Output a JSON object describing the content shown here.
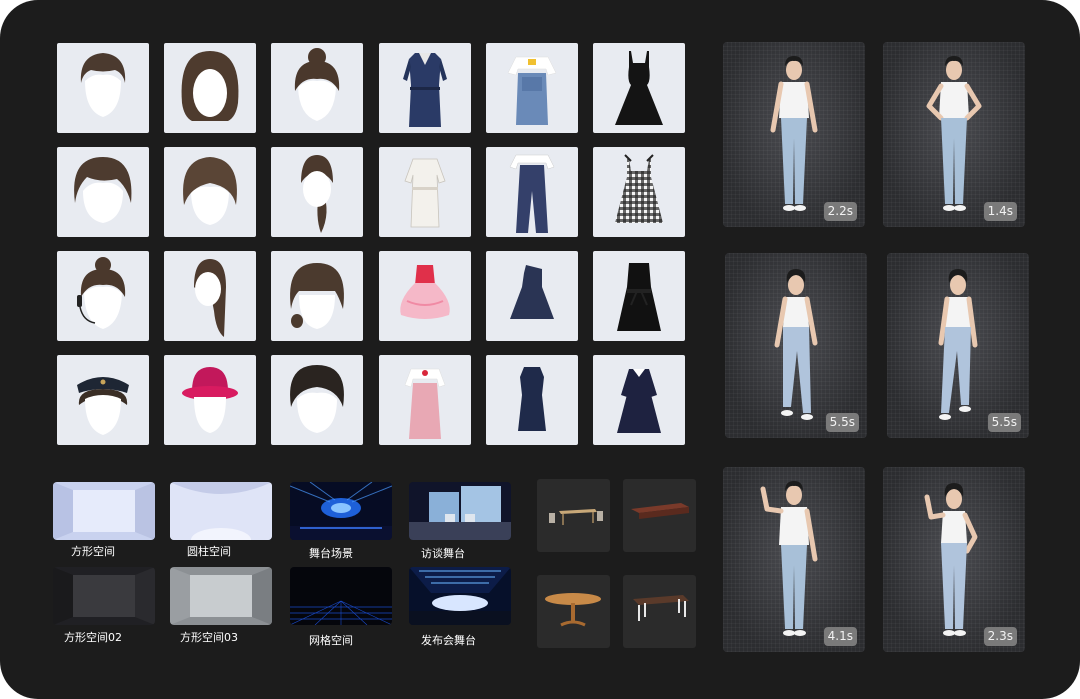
{
  "scene_assets": [
    {
      "id": "square_space",
      "label": "方形空间"
    },
    {
      "id": "cylinder_space",
      "label": "圆柱空间"
    },
    {
      "id": "stage_scene",
      "label": "舞台场景"
    },
    {
      "id": "interview_stage",
      "label": "访谈舞台"
    },
    {
      "id": "square_space_02",
      "label": "方形空间02"
    },
    {
      "id": "square_space_03",
      "label": "方形空间03"
    },
    {
      "id": "grid_space",
      "label": "网格空间"
    },
    {
      "id": "launch_event_stage",
      "label": "发布会舞台"
    }
  ],
  "animations": [
    {
      "duration": "2.2s"
    },
    {
      "duration": "1.4s"
    },
    {
      "duration": "5.5s"
    },
    {
      "duration": "5.5s"
    },
    {
      "duration": "4.1s"
    },
    {
      "duration": "2.3s"
    }
  ],
  "colors": {
    "panel_background": "#1c1c1c",
    "asset_tile_background": "#e8ebf1",
    "duration_badge": "#7a7a7a"
  },
  "icons": {
    "hair": "hairstyle-thumbnail",
    "clothing": "outfit-thumbnail",
    "furniture": "furniture-thumbnail"
  }
}
